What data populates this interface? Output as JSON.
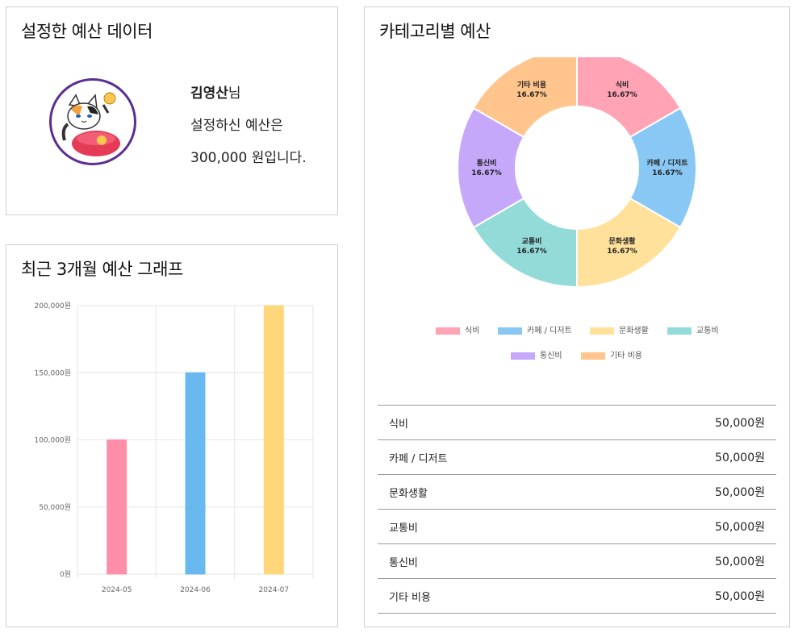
{
  "budget_card": {
    "title": "설정한 예산 데이터",
    "user_name": "김영산",
    "honorific": "님",
    "line2": "설정하신 예산은",
    "amount": "300,000",
    "line3_suffix": " 원입니다."
  },
  "graph_card": {
    "title": "최근 3개월 예산 그래프"
  },
  "category_card": {
    "title": "카테고리별 예산"
  },
  "chart_data": [
    {
      "type": "bar",
      "categories": [
        "2024-05",
        "2024-06",
        "2024-07"
      ],
      "values": [
        100000,
        150000,
        200000
      ],
      "colors": [
        "#ff8fa8",
        "#6ab8f0",
        "#ffd67a"
      ],
      "ylim": [
        0,
        200000
      ],
      "yticks": [
        "0원",
        "50,000원",
        "100,000원",
        "150,000원",
        "200,000원"
      ],
      "grid": true
    },
    {
      "type": "pie",
      "donut": true,
      "labels": [
        "식비",
        "카페 / 디저트",
        "문화생활",
        "교통비",
        "통신비",
        "기타 비용"
      ],
      "values": [
        50000,
        50000,
        50000,
        50000,
        50000,
        50000
      ],
      "percent_labels": [
        "16.67%",
        "16.67%",
        "16.67%",
        "16.67%",
        "16.67%",
        "16.67%"
      ],
      "colors": [
        "#ffa3b5",
        "#89c8f5",
        "#ffe19b",
        "#93dbd9",
        "#c6a8fb",
        "#ffc58c"
      ],
      "legend": "bottom"
    }
  ],
  "table": {
    "rows": [
      {
        "name": "식비",
        "amount": "50,000원"
      },
      {
        "name": "카페 / 디저트",
        "amount": "50,000원"
      },
      {
        "name": "문화생활",
        "amount": "50,000원"
      },
      {
        "name": "교통비",
        "amount": "50,000원"
      },
      {
        "name": "통신비",
        "amount": "50,000원"
      },
      {
        "name": "기타 비용",
        "amount": "50,000원"
      }
    ]
  }
}
